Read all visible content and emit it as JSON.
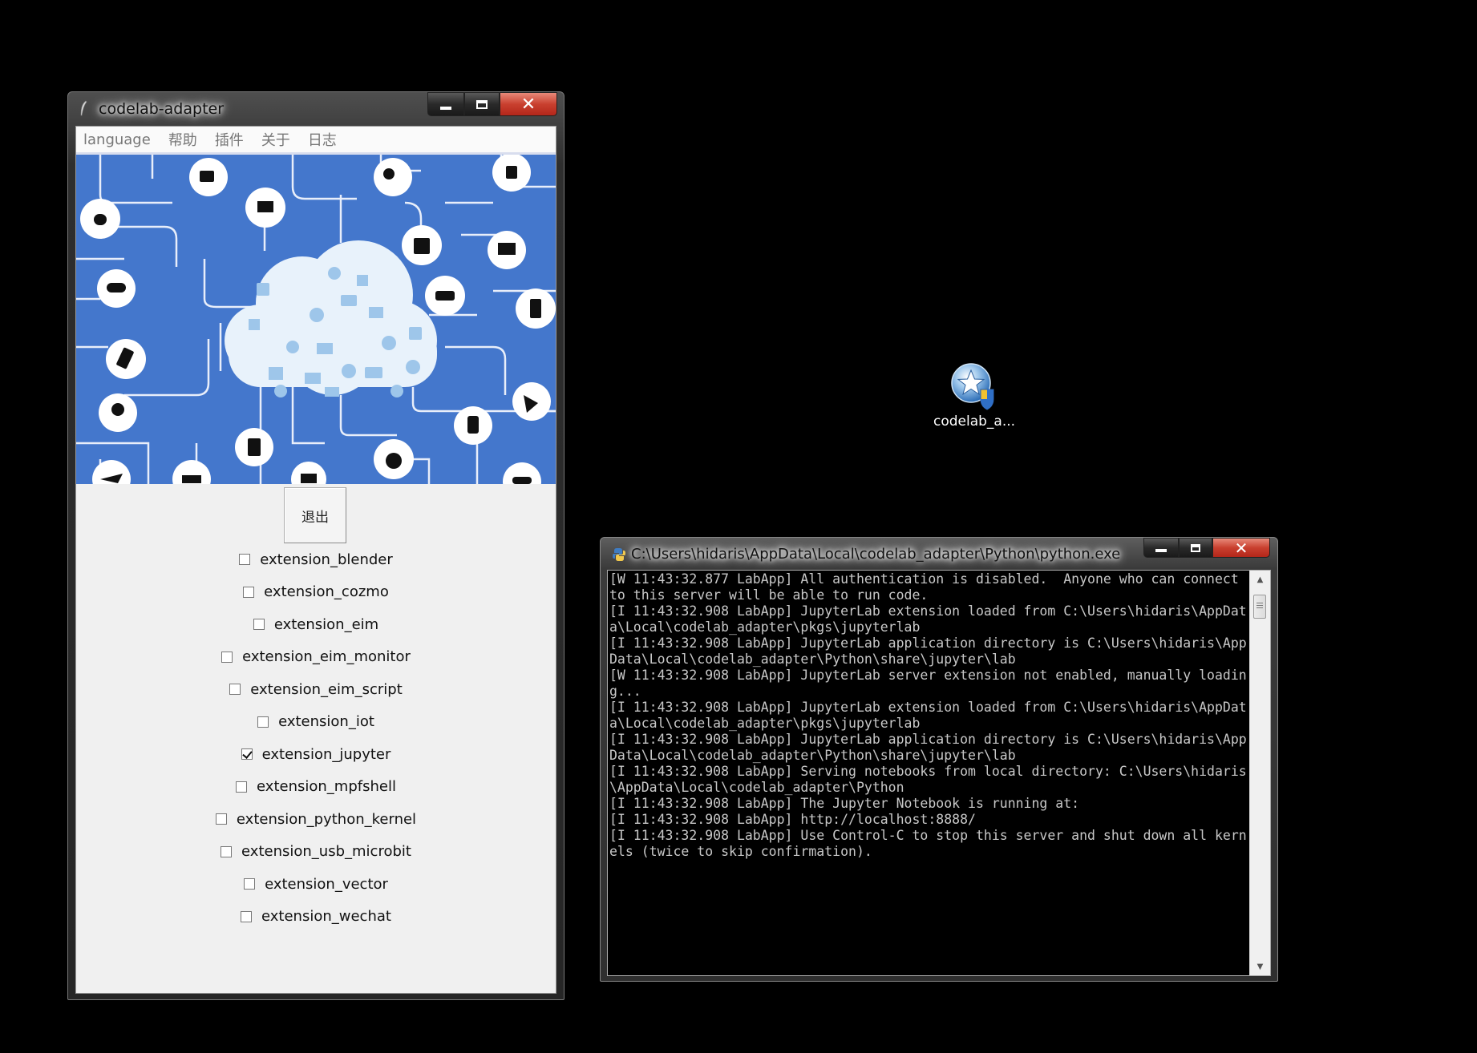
{
  "app_window": {
    "title": "codelab-adapter",
    "controls": {
      "minimize": "minimize",
      "maximize": "maximize",
      "close": "✕"
    },
    "menu": [
      "language",
      "帮助",
      "插件",
      "关于",
      "日志"
    ],
    "quit_label": "退出",
    "extensions": [
      {
        "label": "extension_blender",
        "checked": false
      },
      {
        "label": "extension_cozmo",
        "checked": false
      },
      {
        "label": "extension_eim",
        "checked": false
      },
      {
        "label": "extension_eim_monitor",
        "checked": false
      },
      {
        "label": "extension_eim_script",
        "checked": false
      },
      {
        "label": "extension_iot",
        "checked": false
      },
      {
        "label": "extension_jupyter",
        "checked": true
      },
      {
        "label": "extension_mpfshell",
        "checked": false
      },
      {
        "label": "extension_python_kernel",
        "checked": false
      },
      {
        "label": "extension_usb_microbit",
        "checked": false
      },
      {
        "label": "extension_vector",
        "checked": false
      },
      {
        "label": "extension_wechat",
        "checked": false
      }
    ],
    "banner": {
      "background": "#4477cc",
      "icon": "iot-cloud-network-illustration"
    }
  },
  "desktop_icon": {
    "label": "codelab_a...",
    "icon": "star-shield-icon"
  },
  "console_window": {
    "title": "C:\\Users\\hidaris\\AppData\\Local\\codelab_adapter\\Python\\python.exe",
    "controls": {
      "minimize": "minimize",
      "maximize": "maximize",
      "close": "✕"
    },
    "lines": [
      "[W 11:43:32.877 LabApp] All authentication is disabled.  Anyone who can connect",
      "to this server will be able to run code.",
      "[I 11:43:32.908 LabApp] JupyterLab extension loaded from C:\\Users\\hidaris\\AppDat",
      "a\\Local\\codelab_adapter\\pkgs\\jupyterlab",
      "[I 11:43:32.908 LabApp] JupyterLab application directory is C:\\Users\\hidaris\\App",
      "Data\\Local\\codelab_adapter\\Python\\share\\jupyter\\lab",
      "[W 11:43:32.908 LabApp] JupyterLab server extension not enabled, manually loadin",
      "g...",
      "[I 11:43:32.908 LabApp] JupyterLab extension loaded from C:\\Users\\hidaris\\AppDat",
      "a\\Local\\codelab_adapter\\pkgs\\jupyterlab",
      "[I 11:43:32.908 LabApp] JupyterLab application directory is C:\\Users\\hidaris\\App",
      "Data\\Local\\codelab_adapter\\Python\\share\\jupyter\\lab",
      "[I 11:43:32.908 LabApp] Serving notebooks from local directory: C:\\Users\\hidaris",
      "\\AppData\\Local\\codelab_adapter\\Python",
      "[I 11:43:32.908 LabApp] The Jupyter Notebook is running at:",
      "[I 11:43:32.908 LabApp] http://localhost:8888/",
      "[I 11:43:32.908 LabApp] Use Control-C to stop this server and shut down all kern",
      "els (twice to skip confirmation)."
    ]
  }
}
